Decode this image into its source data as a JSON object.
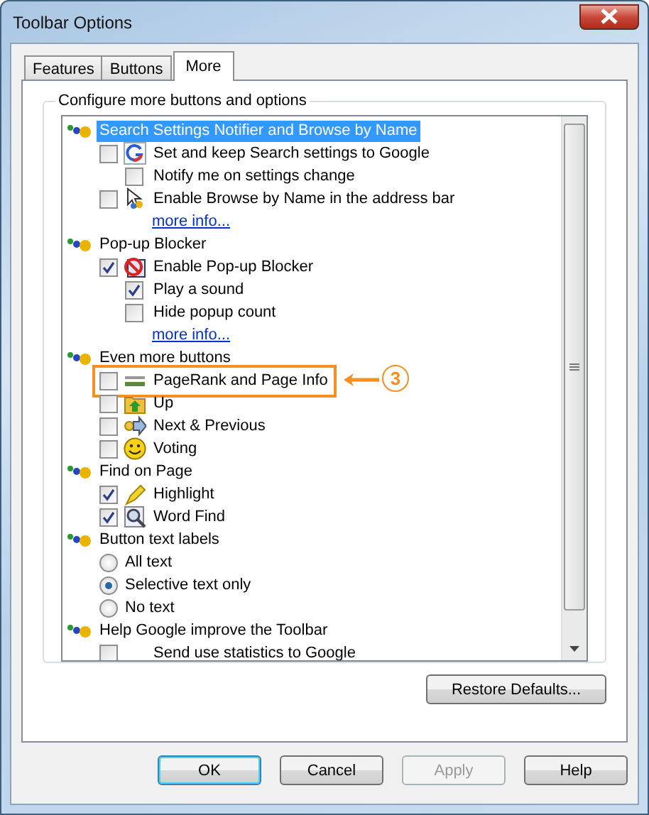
{
  "window": {
    "title": "Toolbar Options"
  },
  "tabs": [
    {
      "label": "Features",
      "selected": false
    },
    {
      "label": "Buttons",
      "selected": false
    },
    {
      "label": "More",
      "selected": true
    }
  ],
  "group_box": {
    "title": "Configure more buttons and options"
  },
  "tree": [
    {
      "label": "Search Settings Notifier and Browse by Name",
      "selected": true,
      "children": [
        {
          "kind": "checkbox",
          "label": "Set and keep Search settings to Google",
          "checked": false,
          "children": [
            {
              "kind": "checkbox",
              "label": "Notify me on settings change",
              "checked": false
            }
          ]
        },
        {
          "kind": "checkbox",
          "label": "Enable Browse by Name in the address bar",
          "checked": false
        },
        {
          "kind": "link",
          "label": "more info..."
        }
      ]
    },
    {
      "label": "Pop-up Blocker",
      "selected": false,
      "children": [
        {
          "kind": "checkbox",
          "label": "Enable Pop-up Blocker",
          "checked": true,
          "children": [
            {
              "kind": "checkbox",
              "label": "Play a sound",
              "checked": true
            },
            {
              "kind": "checkbox",
              "label": "Hide popup count",
              "checked": false
            }
          ]
        },
        {
          "kind": "link",
          "label": "more info..."
        }
      ]
    },
    {
      "label": "Even more buttons",
      "selected": false,
      "children": [
        {
          "kind": "checkbox",
          "label": "PageRank and Page Info",
          "checked": false,
          "callout": "3"
        },
        {
          "kind": "checkbox",
          "label": "Up",
          "checked": false
        },
        {
          "kind": "checkbox",
          "label": "Next & Previous",
          "checked": false
        },
        {
          "kind": "checkbox",
          "label": "Voting",
          "checked": false
        }
      ]
    },
    {
      "label": "Find on Page",
      "selected": false,
      "children": [
        {
          "kind": "checkbox",
          "label": "Highlight",
          "checked": true
        },
        {
          "kind": "checkbox",
          "label": "Word Find",
          "checked": true
        }
      ]
    },
    {
      "label": "Button text labels",
      "selected": false,
      "children": [
        {
          "kind": "radio",
          "label": "All text",
          "selected": false
        },
        {
          "kind": "radio",
          "label": "Selective text only",
          "selected": true
        },
        {
          "kind": "radio",
          "label": "No text",
          "selected": false
        }
      ]
    },
    {
      "label": "Help Google improve the Toolbar",
      "selected": false,
      "children": [
        {
          "kind": "checkbox",
          "label": "Send use statistics to Google",
          "checked": false
        }
      ]
    }
  ],
  "restore_button": {
    "label": "Restore Defaults..."
  },
  "buttons": [
    {
      "label": "OK",
      "default": true,
      "disabled": false
    },
    {
      "label": "Cancel",
      "default": false,
      "disabled": false
    },
    {
      "label": "Apply",
      "default": false,
      "disabled": true
    },
    {
      "label": "Help",
      "default": false,
      "disabled": false
    }
  ]
}
